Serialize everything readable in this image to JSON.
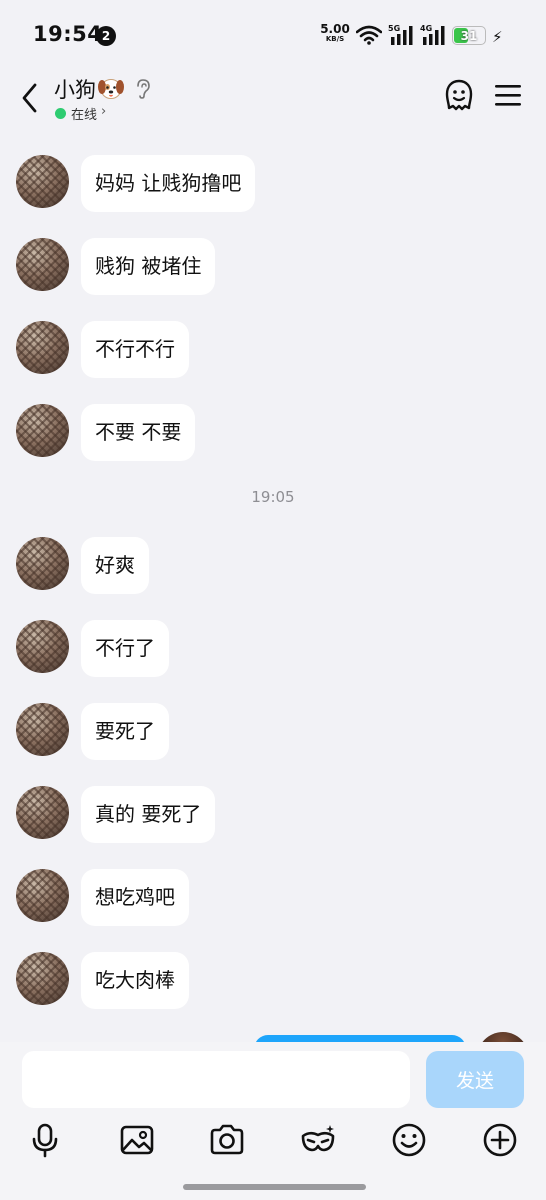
{
  "status_bar": {
    "time": "19:54",
    "notification_count": "2",
    "net_speed_value": "5.00",
    "net_speed_unit": "KB/S",
    "signal_1_label": "5G",
    "signal_2_label": "4G",
    "battery_level": "31",
    "battery_fraction": 0.31,
    "icons": [
      "wifi-icon",
      "signal-icon",
      "signal-icon",
      "battery-icon",
      "charging-bolt-icon"
    ]
  },
  "header": {
    "contact_name": "小狗",
    "status_text": "在线",
    "icons": [
      "back-arrow-icon",
      "dog-emoji",
      "ear-icon",
      "face-icon",
      "menu-icon"
    ]
  },
  "messages_before": [
    {
      "text": "妈妈 让贱狗撸吧"
    },
    {
      "text": "贱狗 被堵住"
    },
    {
      "text": "不行不行"
    },
    {
      "text": "不要 不要"
    }
  ],
  "timestamp": "19:05",
  "messages_after": [
    {
      "text": "好爽"
    },
    {
      "text": "不行了"
    },
    {
      "text": "要死了"
    },
    {
      "text": "真的 要死了"
    },
    {
      "text": "想吃鸡吧"
    },
    {
      "text": "吃大肉棒"
    }
  ],
  "input": {
    "value": "",
    "send_label": "发送"
  },
  "toolbar": {
    "icons": [
      "microphone-icon",
      "image-icon",
      "camera-icon",
      "masquerade-mask-icon",
      "emoji-icon",
      "plus-icon"
    ]
  },
  "colors": {
    "background": "#f2f2f6",
    "bubble": "#ffffff",
    "send_button": "#a9d6fb",
    "self_bubble": "#1ea5fb",
    "online": "#2ecc71",
    "battery": "#3ac54a"
  }
}
